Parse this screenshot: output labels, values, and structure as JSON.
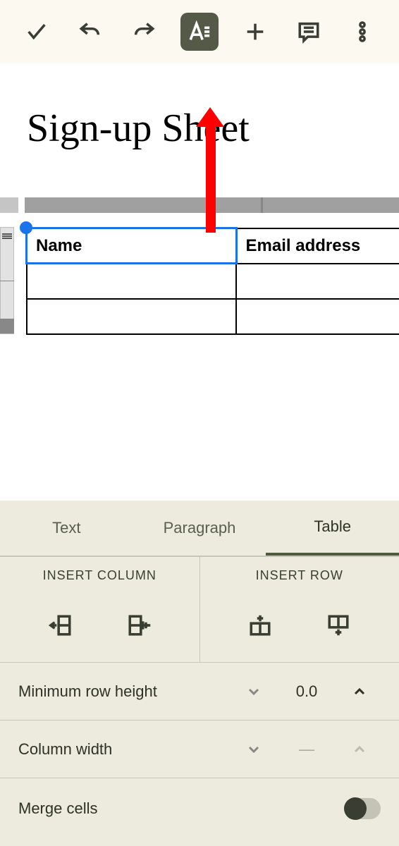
{
  "toolbar": {
    "accept": "Done",
    "undo": "Undo",
    "redo": "Redo",
    "format": "Format",
    "insert": "Insert",
    "comment": "Comment",
    "more": "More"
  },
  "document": {
    "title": "Sign-up Sheet",
    "table": {
      "headers": [
        "Name",
        "Email address"
      ],
      "rows": [
        [
          "",
          ""
        ],
        [
          "",
          ""
        ]
      ]
    }
  },
  "formatPanel": {
    "tabs": [
      "Text",
      "Paragraph",
      "Table"
    ],
    "activeTab": "Table",
    "insertColumn": {
      "label": "INSERT COLUMN"
    },
    "insertRow": {
      "label": "INSERT ROW"
    },
    "rowHeight": {
      "label": "Minimum row height",
      "value": "0.0"
    },
    "colWidth": {
      "label": "Column width",
      "value": "—"
    },
    "mergeCells": {
      "label": "Merge cells",
      "enabled": false
    }
  }
}
